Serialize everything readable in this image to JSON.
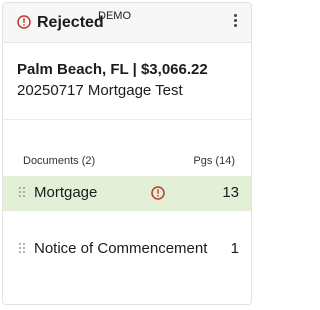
{
  "header": {
    "status": "Rejected",
    "tag": "DEMO",
    "status_icon": "alert-circle-icon",
    "menu_icon": "kebab-menu-icon",
    "status_color": "#c0392b"
  },
  "file": {
    "title": "Palm Beach, FL | $3,066.22",
    "subtitle": "20250717 Mortgage Test"
  },
  "documents": {
    "label": "Documents (2)",
    "pages_label": "Pgs (14)",
    "items": [
      {
        "name": "Mortgage",
        "pages": "13",
        "selected": true,
        "alert": true
      },
      {
        "name": "Notice of Commencement",
        "pages": "1",
        "selected": false,
        "alert": false
      }
    ]
  },
  "colors": {
    "selected_row": "#e4efd7",
    "alert": "#c0392b"
  }
}
